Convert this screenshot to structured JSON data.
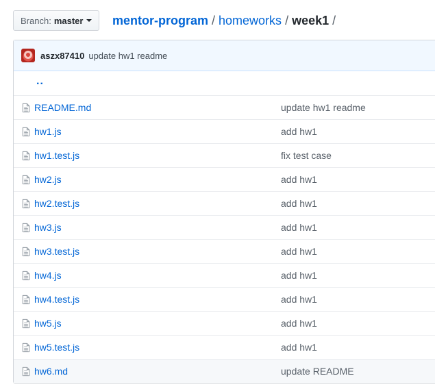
{
  "branch": {
    "prefix": "Branch:",
    "name": "master"
  },
  "breadcrumb": {
    "repo": "mentor-program",
    "sep1": "/",
    "folder": "homeworks",
    "sep2": "/",
    "current": "week1",
    "sep3": "/"
  },
  "commit": {
    "author": "aszx87410",
    "message": "update hw1 readme"
  },
  "parent_link": "..",
  "files": [
    {
      "name": "README.md",
      "message": "update hw1 readme"
    },
    {
      "name": "hw1.js",
      "message": "add hw1"
    },
    {
      "name": "hw1.test.js",
      "message": "fix test case"
    },
    {
      "name": "hw2.js",
      "message": "add hw1"
    },
    {
      "name": "hw2.test.js",
      "message": "add hw1"
    },
    {
      "name": "hw3.js",
      "message": "add hw1"
    },
    {
      "name": "hw3.test.js",
      "message": "add hw1"
    },
    {
      "name": "hw4.js",
      "message": "add hw1"
    },
    {
      "name": "hw4.test.js",
      "message": "add hw1"
    },
    {
      "name": "hw5.js",
      "message": "add hw1"
    },
    {
      "name": "hw5.test.js",
      "message": "add hw1"
    },
    {
      "name": "hw6.md",
      "message": "update README"
    }
  ],
  "colors": {
    "link": "#0366d6",
    "commit_bg": "#f1f8ff",
    "border": "#d1d5da"
  },
  "icons": {
    "file": "file-text-icon",
    "caret": "caret-down-icon",
    "avatar": "user-avatar"
  }
}
